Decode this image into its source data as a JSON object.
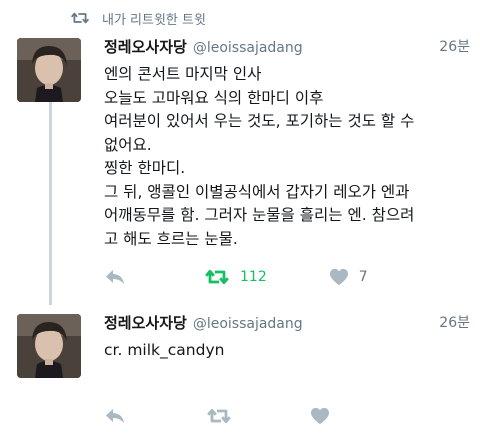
{
  "retweet_header": {
    "text": "내가 리트윗한 트윗"
  },
  "tweets": [
    {
      "display_name": "정레오사자당",
      "handle": "@leoissajadang",
      "time": "26분",
      "lines": [
        "엔의 콘서트 마지막 인사",
        "오늘도 고마워요 식의 한마디 이후",
        "여러분이 있어서 우는 것도, 포기하는 것도 할 수",
        "없어요.",
        "찡한 한마디.",
        "그 뒤, 앵콜인 이별공식에서 갑자기 레오가 엔과",
        "어깨동무를 함. 그러자 눈물을 흘리는 엔. 참으려",
        "고 해도 흐르는 눈물."
      ],
      "retweet_count": "112",
      "like_count": "7",
      "retweeted": true
    },
    {
      "display_name": "정레오사자당",
      "handle": "@leoissajadang",
      "time": "26분",
      "lines": [
        "cr. milk_candyn"
      ],
      "retweet_count": "",
      "like_count": "",
      "retweeted": false
    }
  ],
  "colors": {
    "text": "#14171a",
    "secondary": "#657786",
    "retweet_green": "#17bf63",
    "icon_gray": "#aab8c2",
    "thread_line": "#ccd6dd"
  },
  "icons": {
    "retweet_header": "retweet-icon",
    "reply": "reply-icon",
    "retweet": "retweet-icon",
    "like": "heart-icon"
  }
}
